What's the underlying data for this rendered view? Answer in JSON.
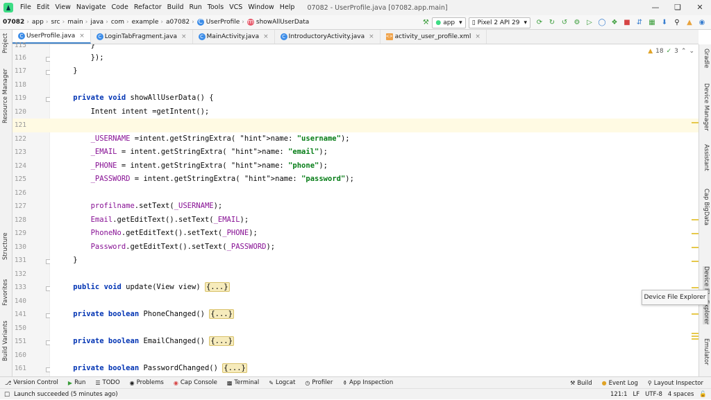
{
  "menu": [
    "File",
    "Edit",
    "View",
    "Navigate",
    "Code",
    "Refactor",
    "Build",
    "Run",
    "Tools",
    "VCS",
    "Window",
    "Help"
  ],
  "window_title": "07082 - UserProfile.java [07082.app.main]",
  "breadcrumb": [
    "07082",
    "app",
    "src",
    "main",
    "java",
    "com",
    "example",
    "a07082",
    "UserProfile",
    "showAllUserData"
  ],
  "toolbar": {
    "run_config": "app",
    "device": "Pixel 2 API 29"
  },
  "tabs": [
    {
      "label": "UserProfile.java",
      "active": true,
      "kind": "class"
    },
    {
      "label": "LoginTabFragment.java",
      "active": false,
      "kind": "class"
    },
    {
      "label": "MainActivity.java",
      "active": false,
      "kind": "class"
    },
    {
      "label": "IntroductoryActivity.java",
      "active": false,
      "kind": "class"
    },
    {
      "label": "activity_user_profile.xml",
      "active": false,
      "kind": "xml"
    }
  ],
  "left_tools": [
    "Project",
    "Resource Manager",
    "Structure",
    "Favorites",
    "Build Variants"
  ],
  "right_tools": [
    "Gradle",
    "Device Manager",
    "Assistant",
    "Cap BigData",
    "Device File Explorer",
    "Emulator"
  ],
  "inspections": {
    "warnings": "18",
    "weak": "3"
  },
  "lines": [
    {
      "n": "115",
      "code": "        }"
    },
    {
      "n": "116",
      "code": "        });"
    },
    {
      "n": "117",
      "code": "    }"
    },
    {
      "n": "118",
      "code": ""
    },
    {
      "n": "119",
      "code": "    private void showAllUserData() {"
    },
    {
      "n": "120",
      "code": "        Intent intent =getIntent();"
    },
    {
      "n": "121",
      "code": ""
    },
    {
      "n": "122",
      "code": "        _USERNAME =intent.getStringExtra( name: \"username\");"
    },
    {
      "n": "123",
      "code": "        _EMAIL = intent.getStringExtra( name: \"email\");"
    },
    {
      "n": "124",
      "code": "        _PHONE = intent.getStringExtra( name: \"phone\");"
    },
    {
      "n": "125",
      "code": "        _PASSWORD = intent.getStringExtra( name: \"password\");"
    },
    {
      "n": "126",
      "code": ""
    },
    {
      "n": "127",
      "code": "        profilname.setText(_USERNAME);"
    },
    {
      "n": "128",
      "code": "        Email.getEditText().setText(_EMAIL);"
    },
    {
      "n": "129",
      "code": "        PhoneNo.getEditText().setText(_PHONE);"
    },
    {
      "n": "130",
      "code": "        Password.getEditText().setText(_PASSWORD);"
    },
    {
      "n": "131",
      "code": "    }"
    },
    {
      "n": "132",
      "code": ""
    },
    {
      "n": "133",
      "code": "    public void update(View view) {...}"
    },
    {
      "n": "140",
      "code": ""
    },
    {
      "n": "141",
      "code": "    private boolean PhoneChanged() {...}"
    },
    {
      "n": "150",
      "code": ""
    },
    {
      "n": "151",
      "code": "    private boolean EmailChanged() {...}"
    },
    {
      "n": "160",
      "code": ""
    },
    {
      "n": "161",
      "code": "    private boolean PasswordChanged() {...}"
    }
  ],
  "tooltip": "Device File Explorer",
  "bottom_tools": [
    "Version Control",
    "Run",
    "TODO",
    "Problems",
    "Cap Console",
    "Terminal",
    "Logcat",
    "Profiler",
    "App Inspection"
  ],
  "bottom_right_tools": [
    "Build",
    "Event Log",
    "Layout Inspector"
  ],
  "status": {
    "message": "Launch succeeded (5 minutes ago)",
    "position": "121:1",
    "line_sep": "LF",
    "encoding": "UTF-8",
    "indent": "4 spaces"
  }
}
